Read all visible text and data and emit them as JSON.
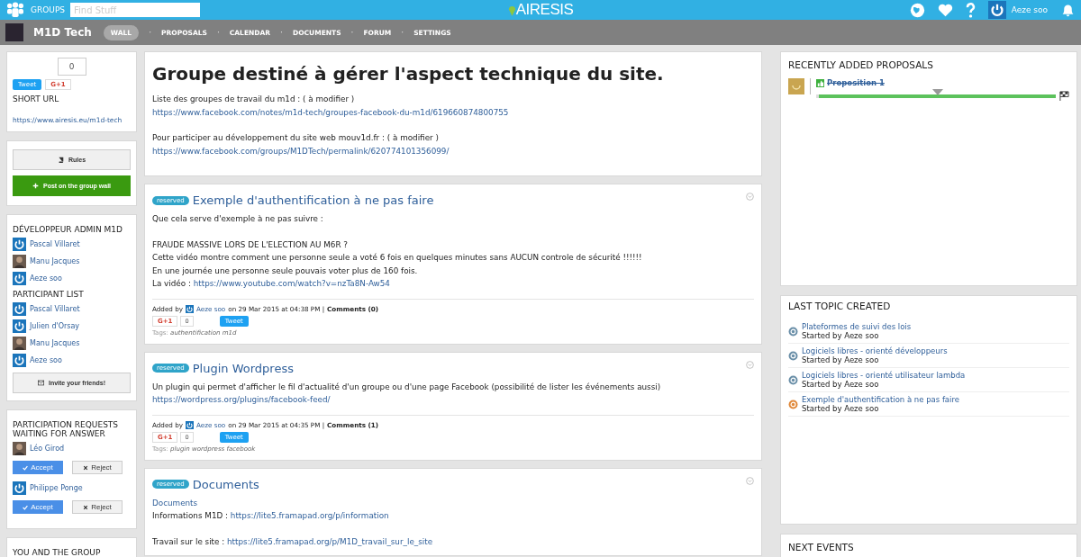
{
  "topbar": {
    "groups_label": "GROUPS",
    "search_placeholder": "Find Stuff",
    "logo": "AIRESIS",
    "user_name": "Aeze soo"
  },
  "group": {
    "name": "M1D Tech",
    "separator": "·",
    "tabs": [
      {
        "label": "WALL",
        "selected": true
      },
      {
        "label": "PROPOSALS",
        "selected": false
      },
      {
        "label": "CALENDAR",
        "selected": false
      },
      {
        "label": "DOCUMENTS",
        "selected": false
      },
      {
        "label": "FORUM",
        "selected": false
      },
      {
        "label": "SETTINGS",
        "selected": false
      }
    ]
  },
  "left": {
    "share": {
      "count": "0",
      "tweet": "Tweet",
      "gplus": "G+1"
    },
    "short_url": {
      "heading": "SHORT URL",
      "url": "https://www.airesis.eu/m1d-tech"
    },
    "actions": [
      {
        "label": "Rules",
        "kind": "rules"
      },
      {
        "label": "Post on the group wall",
        "kind": "post"
      }
    ],
    "member_lists": [
      {
        "heading": "DÉVELOPPEUR ADMIN M1D",
        "members": [
          {
            "name": "Pascal Villaret",
            "kind": "power"
          },
          {
            "name": "Manu Jacques",
            "kind": "photo"
          },
          {
            "name": "Aeze soo",
            "kind": "power"
          }
        ]
      },
      {
        "heading": "PARTICIPANT LIST",
        "members": [
          {
            "name": "Pascal Villaret",
            "kind": "power"
          },
          {
            "name": "Julien d'Orsay",
            "kind": "power"
          },
          {
            "name": "Manu Jacques",
            "kind": "photo"
          },
          {
            "name": "Aeze soo",
            "kind": "power"
          }
        ]
      }
    ],
    "invite": "Invite your friends!",
    "requests": {
      "heading": "PARTICIPATION REQUESTS WAITING FOR ANSWER",
      "items": [
        {
          "name": "Léo Girod",
          "kind": "photo",
          "accept": "Accept",
          "reject": "Reject"
        },
        {
          "name": "Philippe Ponge",
          "kind": "power",
          "accept": "Accept",
          "reject": "Reject"
        }
      ]
    },
    "next_heading": "YOU AND THE GROUP"
  },
  "intro": {
    "title": "Groupe destiné à gérer l'aspect technique du site.",
    "lines": [
      {
        "text": "Liste des groupes de travail du m1d : ( à modifier )"
      },
      {
        "link": "https://www.facebook.com/notes/m1d-tech/groupes-facebook-du-m1d/619660874800755"
      },
      {
        "text": "Pour participer au développement du site web mouv1d.fr : ( à modifier )",
        "gap_before": true
      },
      {
        "link": "https://www.facebook.com/groups/M1DTech/permalink/620774101356099/"
      }
    ]
  },
  "posts": [
    {
      "badge": "reserved",
      "title": "Exemple d'authentification à ne pas faire",
      "lines": [
        {
          "text": "Que cela serve d'exemple à ne pas suivre :"
        },
        {
          "text": "FRAUDE MASSIVE LORS DE L'ELECTION AU M6R ?",
          "gap_before": true
        },
        {
          "text": "Cette vidéo montre comment une personne seule a voté 6 fois en quelques minutes sans AUCUN controle de sécurité !!!!!!"
        },
        {
          "text": "En une journée une personne seule pouvais voter plus de 160 fois."
        },
        {
          "text": "La vidéo : ",
          "link": "https://www.youtube.com/watch?v=nzTa8N-Aw54"
        }
      ],
      "meta": {
        "added_by": "Added by",
        "author": "Aeze soo",
        "date": "on 29 Mar 2015 at 04:38 PM |",
        "comments": "Comments (0)"
      },
      "share": {
        "gplus": "G+1",
        "count": "0",
        "tweet": "Tweet"
      },
      "tags_label": "Tags:",
      "tags": "authentification m1d"
    },
    {
      "badge": "reserved",
      "title": "Plugin Wordpress",
      "lines": [
        {
          "text": "Un plugin qui permet d'afficher le fil d'actualité d'un groupe ou d'une page Facebook (possibilité de lister les événements aussi)"
        },
        {
          "link": "https://wordpress.org/plugins/facebook-feed/"
        }
      ],
      "meta": {
        "added_by": "Added by",
        "author": "Aeze soo",
        "date": "on 29 Mar 2015 at 04:35 PM |",
        "comments": "Comments (1)"
      },
      "share": {
        "gplus": "G+1",
        "count": "0",
        "tweet": "Tweet"
      },
      "tags_label": "Tags:",
      "tags": "plugin wordpress facebook"
    },
    {
      "badge": "reserved",
      "title": "Documents",
      "lines": [
        {
          "link": "Documents"
        },
        {
          "text": "Informations M1D : ",
          "link": "https://lite5.framapad.org/p/information"
        },
        {
          "text": "Travail sur le site : ",
          "link": "https://lite5.framapad.org/p/M1D_travail_sur_le_site",
          "gap_before": true
        }
      ]
    }
  ],
  "right": {
    "proposals": {
      "heading": "RECENTLY ADDED PROPOSALS",
      "items": [
        {
          "title": "Proposition 1",
          "level": 0.5
        }
      ]
    },
    "topics": {
      "heading": "LAST TOPIC CREATED",
      "items": [
        {
          "title": "Plateformes de suivi des lois",
          "started": "Started by Aeze soo",
          "color": "#6a8fa8"
        },
        {
          "title": "Logiciels libres - orienté développeurs",
          "started": "Started by Aeze soo",
          "color": "#6a8fa8"
        },
        {
          "title": "Logiciels libres - orienté utilisateur lambda",
          "started": "Started by Aeze soo",
          "color": "#6a8fa8"
        },
        {
          "title": "Exemple d'authentification à ne pas faire",
          "started": "Started by Aeze soo",
          "color": "#e0883a"
        }
      ]
    },
    "events_heading": "NEXT EVENTS"
  }
}
